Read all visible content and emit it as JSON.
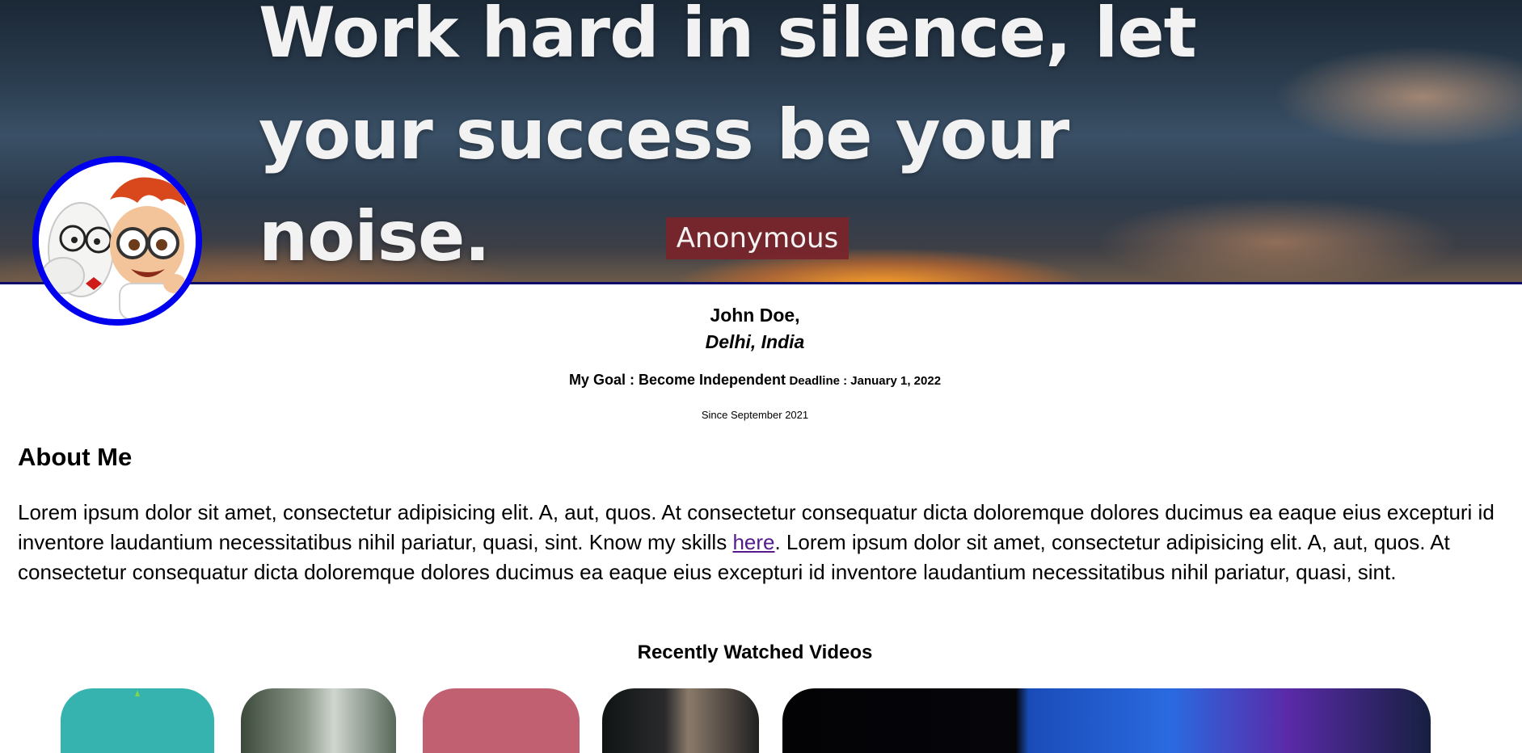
{
  "hero": {
    "quote_line1": "Work hard in silence, let",
    "quote_line2": "your success be your noise.",
    "author": "Anonymous"
  },
  "profile": {
    "name": "John Doe,",
    "location": "Delhi, India",
    "goal": "My Goal : Become Independent",
    "deadline": "Deadline : January 1, 2022",
    "since": "Since September 2021"
  },
  "about": {
    "heading": "About Me",
    "text_before_link": "Lorem ipsum dolor sit amet, consectetur adipisicing elit. A, aut, quos. At consectetur consequatur dicta doloremque dolores ducimus ea eaque eius excepturi id inventore laudantium necessitatibus nihil pariatur, quasi, sint. Know my skills ",
    "link_text": "here",
    "text_after_link": ". Lorem ipsum dolor sit amet, consectetur adipisicing elit. A, aut, quos. At consectetur consequatur dicta doloremque dolores ducimus ea eaque eius excepturi id inventore laudantium necessitatibus nihil pariatur, quasi, sint."
  },
  "videos": {
    "heading": "Recently Watched Videos"
  },
  "colors": {
    "avatar_ring": "#0000ee",
    "banner_border": "#0c0c6a",
    "author_badge": "#7a242a",
    "link": "#551a8b"
  }
}
